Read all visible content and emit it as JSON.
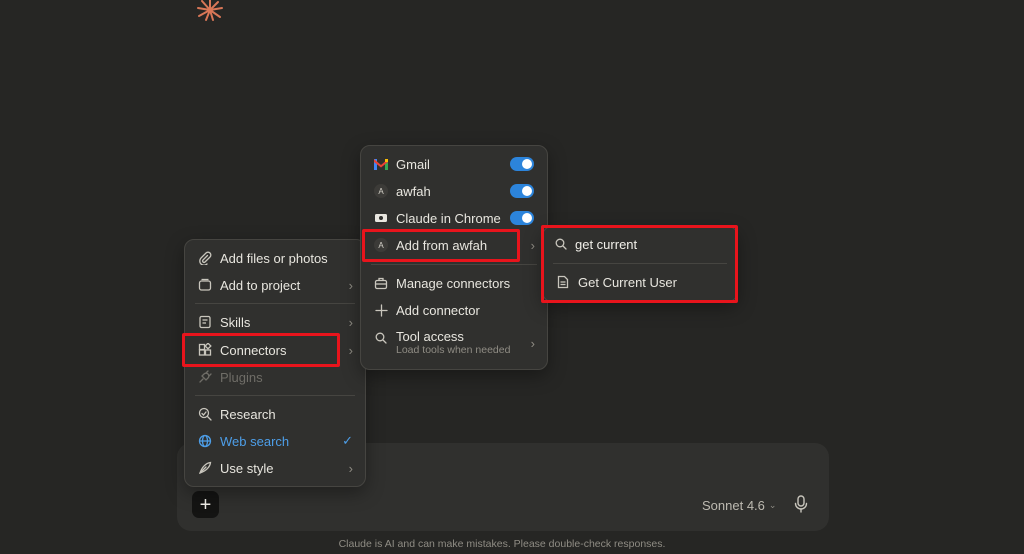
{
  "composer": {
    "plus_label": "+",
    "model": "Sonnet 4.6",
    "disclaimer": "Claude is AI and can make mistakes. Please double-check responses."
  },
  "main_menu": {
    "items": [
      {
        "label": "Add files or photos",
        "icon": "paperclip-icon"
      },
      {
        "label": "Add to project",
        "icon": "folder-icon"
      },
      {
        "label": "Skills",
        "icon": "skills-icon"
      },
      {
        "label": "Connectors",
        "icon": "connectors-icon"
      },
      {
        "label": "Plugins",
        "icon": "plug-icon"
      },
      {
        "label": "Research",
        "icon": "research-icon"
      },
      {
        "label": "Web search",
        "icon": "globe-icon"
      },
      {
        "label": "Use style",
        "icon": "feather-icon"
      }
    ]
  },
  "connectors_menu": {
    "items": [
      {
        "label": "Gmail",
        "icon": "gmail-icon",
        "enabled": true
      },
      {
        "label": "awfah",
        "icon": "avatar-a-icon",
        "avatar": "A",
        "enabled": true
      },
      {
        "label": "Claude in Chrome",
        "icon": "chrome-ext-icon",
        "enabled": true
      },
      {
        "label": "Add from awfah",
        "icon": "avatar-a-icon",
        "avatar": "A"
      },
      {
        "label": "Manage connectors",
        "icon": "toolbox-icon"
      },
      {
        "label": "Add connector",
        "icon": "plus-icon"
      },
      {
        "label": "Tool access",
        "icon": "search-icon",
        "sublabel": "Load tools when needed"
      }
    ]
  },
  "tools_menu": {
    "search_value": "get current",
    "results": [
      {
        "label": "Get Current User",
        "icon": "document-icon"
      }
    ]
  },
  "colors": {
    "background": "#262624",
    "menu": "#30302e",
    "accent": "#4d9ee8",
    "toggle": "#2c84db",
    "highlight": "#e8141c",
    "logo": "#d97757"
  }
}
